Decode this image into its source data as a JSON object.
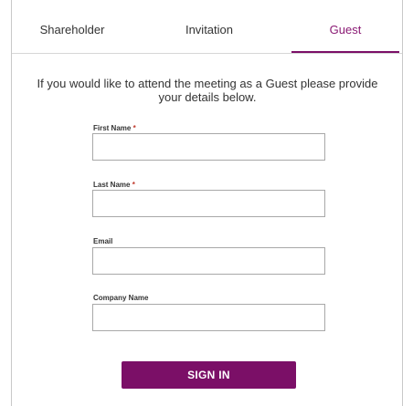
{
  "tabs": [
    {
      "label": "Shareholder"
    },
    {
      "label": "Invitation"
    },
    {
      "label": "Guest"
    }
  ],
  "active_tab": "Guest",
  "intro_text": "If you would like to attend the meeting as a Guest please provide your details below.",
  "form": {
    "first_name": {
      "label": "First Name",
      "required_mark": "*",
      "value": ""
    },
    "last_name": {
      "label": "Last Name",
      "required_mark": "*",
      "value": ""
    },
    "email": {
      "label": "Email",
      "value": ""
    },
    "company_name": {
      "label": "Company Name",
      "value": ""
    }
  },
  "submit_label": "SIGN IN",
  "colors": {
    "accent": "#7b0f67",
    "required": "#c0392b"
  }
}
